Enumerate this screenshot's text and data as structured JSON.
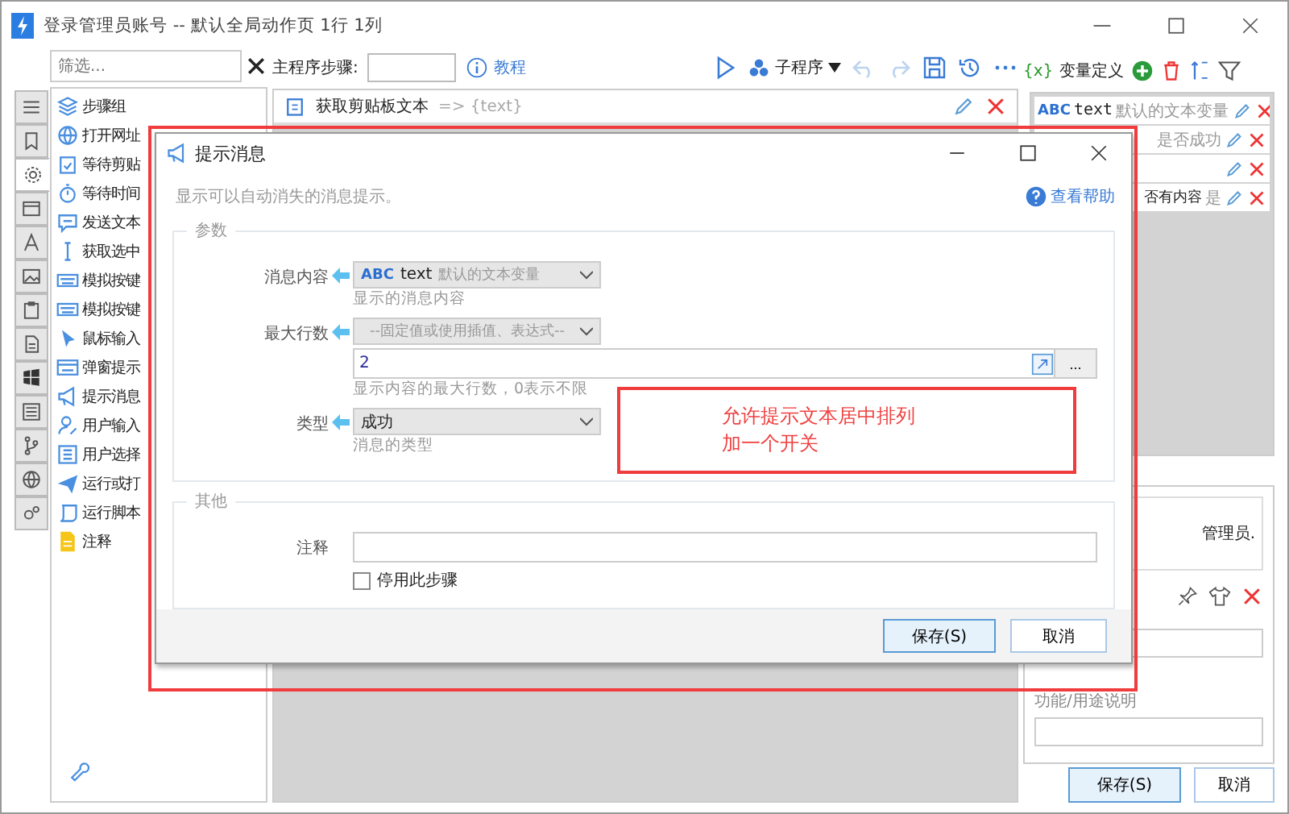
{
  "window": {
    "title": "登录管理员账号 -- 默认全局动作页 1行 1列"
  },
  "side_tabs": [
    {
      "kind": "list",
      "selected": false
    },
    {
      "kind": "bookmark",
      "selected": false
    },
    {
      "kind": "gear",
      "selected": true
    },
    {
      "kind": "window",
      "selected": false
    },
    {
      "kind": "letter",
      "selected": false
    },
    {
      "kind": "image",
      "selected": false
    },
    {
      "kind": "clipboard",
      "selected": false
    },
    {
      "kind": "document",
      "selected": false
    },
    {
      "kind": "tiles",
      "selected": false
    },
    {
      "kind": "calculator",
      "selected": false
    },
    {
      "kind": "branch",
      "selected": false
    },
    {
      "kind": "globe",
      "selected": false
    },
    {
      "kind": "gears",
      "selected": false
    }
  ],
  "filter": {
    "placeholder": "筛选..."
  },
  "actions": [
    {
      "kind": "layers",
      "label": "步骤组"
    },
    {
      "kind": "globe",
      "label": "打开网址"
    },
    {
      "kind": "clipboard",
      "label": "等待剪贴"
    },
    {
      "kind": "timer",
      "label": "等待时间"
    },
    {
      "kind": "chat",
      "label": "发送文本"
    },
    {
      "kind": "cursor",
      "label": "获取选中"
    },
    {
      "kind": "keyboard",
      "label": "模拟按键"
    },
    {
      "kind": "keyboard",
      "label": "模拟按键"
    },
    {
      "kind": "pointer",
      "label": "鼠标输入"
    },
    {
      "kind": "popup",
      "label": "弹窗提示"
    },
    {
      "kind": "megaphone",
      "label": "提示消息"
    },
    {
      "kind": "user",
      "label": "用户输入"
    },
    {
      "kind": "listbox",
      "label": "用户选择"
    },
    {
      "kind": "plane",
      "label": "运行或打"
    },
    {
      "kind": "scroll",
      "label": "运行脚本"
    },
    {
      "kind": "note",
      "label": "注释"
    }
  ],
  "main": {
    "steps_label": "主程序步骤:",
    "tutorial": "教程",
    "subprogram": "子程序",
    "steps": [
      {
        "title": "获取剪贴板文本",
        "output": "=> {text}"
      }
    ]
  },
  "variables": {
    "title": "变量定义",
    "badge": "{x}",
    "items": [
      {
        "kind": "text",
        "type_label": "ABC",
        "name": "text",
        "desc": "默认的文本变量"
      },
      {
        "kind": "bool",
        "desc": "是否成功"
      },
      {
        "kind": "hidden"
      },
      {
        "kind": "hidden",
        "name": "否有内容",
        "desc": "是"
      }
    ]
  },
  "details": {
    "note": "管理员.",
    "purpose_label": "功能/用途说明",
    "buttons": [
      "保存(S)",
      "取消"
    ]
  },
  "dialog": {
    "title": "提示消息",
    "description": "显示可以自动消失的消息提示。",
    "help": "查看帮助",
    "params_title": "参数",
    "message": {
      "label": "消息内容",
      "type_label": "ABC",
      "value": "text",
      "value_desc": "默认的文本变量",
      "hint": "显示的消息内容"
    },
    "max_lines": {
      "label": "最大行数",
      "placeholder": "--固定值或使用插值、表达式--",
      "value": "2",
      "more": "...",
      "hint": "显示内容的最大行数，0表示不限"
    },
    "type": {
      "label": "类型",
      "value": "成功",
      "hint": "消息的类型"
    },
    "other_title": "其他",
    "comment": {
      "label": "注释"
    },
    "disable": {
      "label": "停用此步骤",
      "checked": false
    },
    "buttons": [
      {
        "label": "保存(S)",
        "default": true
      },
      {
        "label": "取消",
        "default": false
      }
    ]
  },
  "annotation": {
    "lines": [
      "允许提示文本居中排列",
      "加一个开关"
    ]
  }
}
